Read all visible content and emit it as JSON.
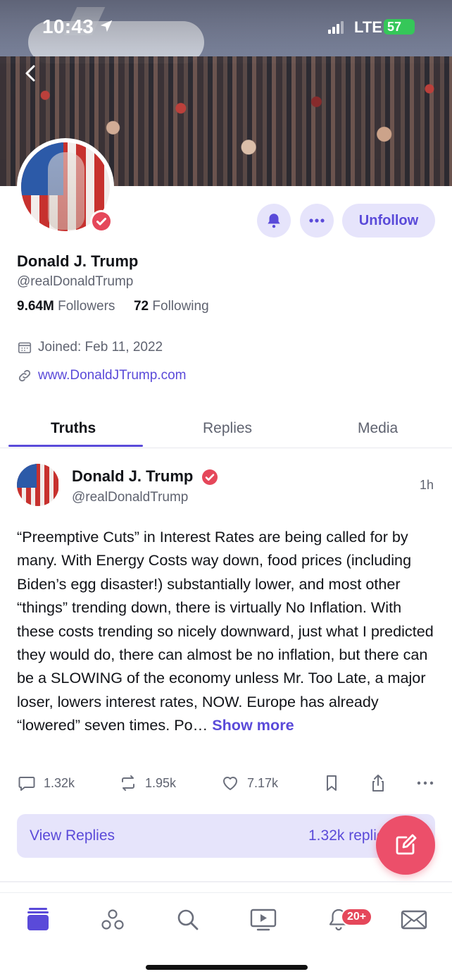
{
  "status_bar": {
    "time": "10:43",
    "network": "LTE",
    "battery": "57"
  },
  "profile": {
    "display_name": "Donald J. Trump",
    "handle": "@realDonaldTrump",
    "followers_count": "9.64M",
    "followers_label": "Followers",
    "following_count": "72",
    "following_label": "Following",
    "joined": "Joined: Feb 11, 2022",
    "website": "www.DonaldJTrump.com",
    "unfollow_label": "Unfollow"
  },
  "tabs": [
    {
      "label": "Truths",
      "active": true
    },
    {
      "label": "Replies",
      "active": false
    },
    {
      "label": "Media",
      "active": false
    }
  ],
  "post": {
    "author": "Donald J. Trump",
    "handle": "@realDonaldTrump",
    "time": "1h",
    "text": "“Preemptive Cuts” in Interest Rates are being called for by many. With Energy Costs way down, food prices (including Biden’s egg disaster!) substantially lower, and most other “things” trending down, there is virtually No Inflation. With these costs trending so nicely downward, just what I predicted they would do, there can almost be no inflation, but there can be a SLOWING of the economy unless Mr. Too Late, a major loser, lowers interest rates, NOW. Europe has already “lowered” seven times. Po…",
    "show_more": "Show more",
    "replies": "1.32k",
    "retruths": "1.95k",
    "likes": "7.17k",
    "view_replies_label": "View Replies",
    "view_replies_count": "1.32k replies"
  },
  "nav": {
    "notifications_badge": "20+"
  },
  "colors": {
    "accent": "#5a4ad9",
    "accent_soft": "#e6e4fb",
    "fab": "#ec4f6a",
    "verified": "#e5475a"
  }
}
